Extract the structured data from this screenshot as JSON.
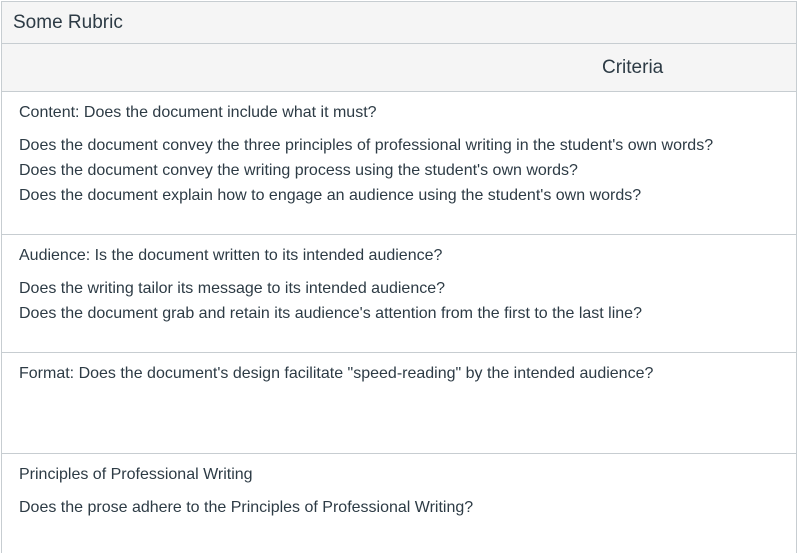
{
  "rubric": {
    "title": "Some Rubric",
    "header": {
      "criteria_label": "Criteria"
    },
    "criteria": [
      {
        "description": "Content: Does the document include what it must?",
        "long_description": [
          "Does the document convey the three principles of professional writing in the student's own words?",
          "Does the document convey the writing process using the student's own words?",
          "Does the document explain how to engage an audience using the student's own words?"
        ]
      },
      {
        "description": "Audience: Is the document written to its intended audience?",
        "long_description": [
          "Does the writing tailor its message to its intended audience?",
          "Does the document grab and retain its audience's attention from the first to the last line?"
        ]
      },
      {
        "description": "Format: Does the document's design facilitate \"speed-reading\" by the intended audience?",
        "long_description": []
      },
      {
        "description": "Principles of Professional Writing",
        "long_description": [
          "Does the prose adhere to the Principles of Professional Writing?"
        ]
      }
    ]
  }
}
